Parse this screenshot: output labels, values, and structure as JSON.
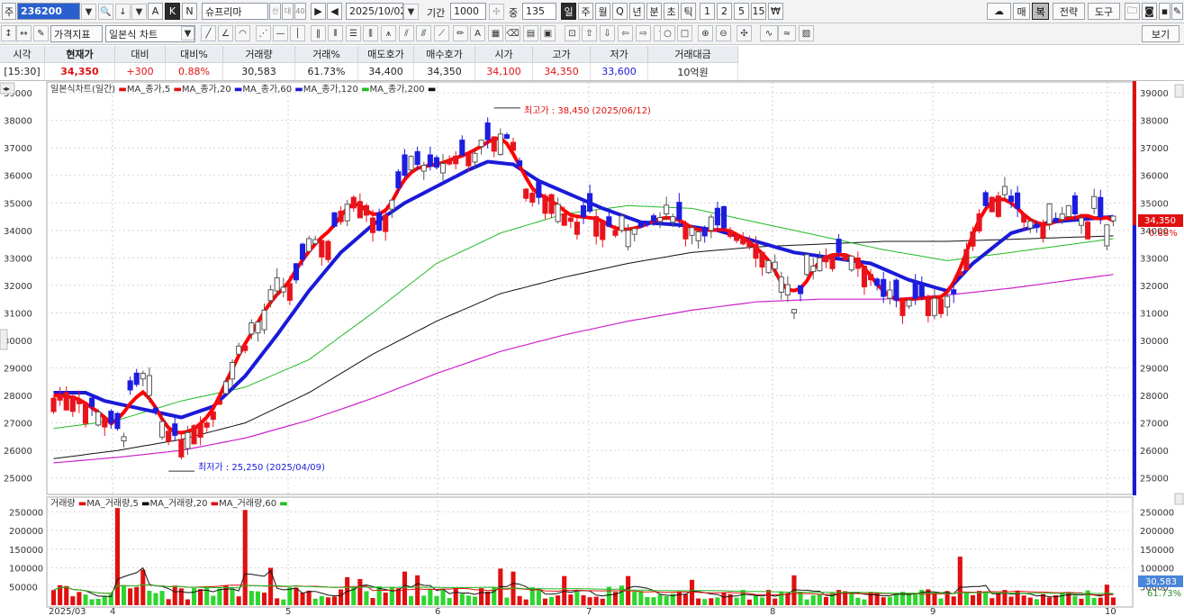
{
  "toolbar": {
    "code_prefix": "주",
    "code": "236200",
    "name": "슈프리마",
    "name_badges": [
      "신",
      "대",
      "40"
    ],
    "date": "2025/10/02",
    "period_label": "기간",
    "period_value": "1000",
    "count_label": "중",
    "count_value": "135",
    "intervals": [
      "일",
      "주",
      "월",
      "Q",
      "년",
      "분",
      "초",
      "틱",
      "1",
      "2",
      "5",
      "15"
    ],
    "right_buttons": [
      "매",
      "복",
      "전략",
      "도구"
    ],
    "letters": [
      "A",
      "K",
      "N"
    ]
  },
  "toolbar2": {
    "price_indicator": "가격지표",
    "chart_type": "일본식 차트",
    "view_label": "보기"
  },
  "info": {
    "headers": [
      "시각",
      "현재가",
      "대비",
      "대비%",
      "거래량",
      "거래%",
      "매도호가",
      "매수호가",
      "시가",
      "고가",
      "저가",
      "거래대금"
    ],
    "values": [
      "[15:30]",
      "34,350",
      "+300",
      "0.88%",
      "30,583",
      "61.73%",
      "34,400",
      "34,350",
      "34,100",
      "34,350",
      "33,600",
      "10억원"
    ]
  },
  "colors": {
    "up": "#e8141c",
    "down": "#1d1de0",
    "ma5": "#ff0000",
    "ma20": "#1a1ad8",
    "ma60": "#22bb22",
    "ma120": "#111111",
    "ma200": "#cc22cc",
    "vol_up": "#e01010",
    "vol_down": "#2fd52f"
  },
  "chart_data": {
    "type": "candlestick",
    "legend_main": [
      "일본식차트(일간)",
      "MA_종가,5",
      "MA_종가,20",
      "MA_종가,60",
      "MA_종가,120",
      "MA_종가,200"
    ],
    "legend_volume": [
      "거래량",
      "MA_거래량,5",
      "MA_거래량,20",
      "MA_거래량,60"
    ],
    "ylim": [
      24500,
      39200
    ],
    "y_ticks": [
      25000,
      26000,
      27000,
      28000,
      29000,
      30000,
      31000,
      32000,
      33000,
      34000,
      35000,
      36000,
      37000,
      38000,
      39000
    ],
    "vol_ticks": [
      "50000",
      "100000",
      "150000",
      "200000",
      "250000"
    ],
    "x_labels": [
      "2025/03",
      "4",
      "5",
      "6",
      "7",
      "8",
      "9",
      "10"
    ],
    "annotations": {
      "high": "최고가 : 38,450 (2025/06/12)",
      "low": "최저가 : 25,250 (2025/04/09)"
    },
    "last_price": "34,350",
    "last_change": "0.88%",
    "last_volume": "30,583",
    "last_volume_pct": "61.73%",
    "anchors": [
      [
        0,
        27900
      ],
      [
        2,
        28100
      ],
      [
        6,
        27600
      ],
      [
        8,
        27200
      ],
      [
        10,
        26800
      ],
      [
        11,
        26500
      ],
      [
        12,
        28200
      ],
      [
        14,
        28600
      ],
      [
        16,
        27400
      ],
      [
        18,
        26700
      ],
      [
        20,
        26400
      ],
      [
        22,
        26900
      ],
      [
        24,
        27000
      ],
      [
        26,
        27800
      ],
      [
        28,
        29200
      ],
      [
        30,
        29800
      ],
      [
        33,
        31100
      ],
      [
        35,
        31800
      ],
      [
        38,
        32200
      ],
      [
        40,
        33700
      ],
      [
        43,
        33600
      ],
      [
        45,
        34700
      ],
      [
        47,
        35200
      ],
      [
        49,
        34900
      ],
      [
        51,
        34000
      ],
      [
        53,
        35100
      ],
      [
        55,
        36000
      ],
      [
        57,
        36400
      ],
      [
        60,
        36300
      ],
      [
        63,
        36700
      ],
      [
        66,
        36800
      ],
      [
        68,
        37300
      ],
      [
        70,
        37500
      ],
      [
        72,
        37200
      ],
      [
        74,
        35500
      ],
      [
        76,
        35200
      ],
      [
        78,
        35300
      ],
      [
        80,
        34600
      ],
      [
        82,
        34300
      ],
      [
        84,
        34700
      ],
      [
        86,
        34300
      ],
      [
        88,
        34000
      ],
      [
        90,
        34000
      ],
      [
        93,
        34200
      ],
      [
        96,
        34600
      ],
      [
        98,
        34400
      ],
      [
        100,
        34100
      ],
      [
        102,
        33800
      ],
      [
        104,
        34200
      ],
      [
        106,
        34000
      ],
      [
        108,
        33700
      ],
      [
        110,
        33500
      ],
      [
        112,
        32900
      ],
      [
        114,
        32300
      ],
      [
        116,
        31000
      ],
      [
        118,
        32400
      ],
      [
        120,
        33000
      ],
      [
        123,
        33200
      ],
      [
        126,
        33000
      ],
      [
        128,
        32400
      ],
      [
        130,
        31600
      ],
      [
        133,
        31400
      ],
      [
        136,
        31600
      ],
      [
        139,
        31500
      ],
      [
        141,
        31700
      ],
      [
        143,
        33300
      ],
      [
        145,
        34600
      ],
      [
        147,
        35200
      ],
      [
        149,
        35300
      ],
      [
        151,
        34800
      ],
      [
        154,
        34100
      ],
      [
        157,
        34300
      ],
      [
        160,
        34600
      ],
      [
        162,
        34300
      ],
      [
        163,
        34800
      ],
      [
        165,
        34200
      ],
      [
        166,
        34350
      ]
    ],
    "ma20_anchors": [
      [
        0,
        28100
      ],
      [
        5,
        28100
      ],
      [
        8,
        27800
      ],
      [
        12,
        27600
      ],
      [
        20,
        27200
      ],
      [
        25,
        27600
      ],
      [
        30,
        28700
      ],
      [
        35,
        30200
      ],
      [
        40,
        31800
      ],
      [
        45,
        33200
      ],
      [
        50,
        34200
      ],
      [
        55,
        35000
      ],
      [
        60,
        35600
      ],
      [
        65,
        36200
      ],
      [
        68,
        36500
      ],
      [
        72,
        36400
      ],
      [
        76,
        35800
      ],
      [
        80,
        35400
      ],
      [
        86,
        34800
      ],
      [
        92,
        34300
      ],
      [
        98,
        34200
      ],
      [
        104,
        34000
      ],
      [
        110,
        33600
      ],
      [
        116,
        33200
      ],
      [
        122,
        33000
      ],
      [
        128,
        32800
      ],
      [
        134,
        32200
      ],
      [
        140,
        31800
      ],
      [
        144,
        32800
      ],
      [
        150,
        33900
      ],
      [
        156,
        34300
      ],
      [
        166,
        34500
      ]
    ],
    "ma60_anchors": [
      [
        0,
        26800
      ],
      [
        10,
        27100
      ],
      [
        20,
        27800
      ],
      [
        30,
        28300
      ],
      [
        40,
        29300
      ],
      [
        50,
        31000
      ],
      [
        60,
        32800
      ],
      [
        70,
        33900
      ],
      [
        80,
        34600
      ],
      [
        90,
        34900
      ],
      [
        100,
        34800
      ],
      [
        110,
        34300
      ],
      [
        120,
        33800
      ],
      [
        130,
        33300
      ],
      [
        140,
        32900
      ],
      [
        150,
        33200
      ],
      [
        166,
        33700
      ]
    ],
    "ma120_anchors": [
      [
        0,
        25700
      ],
      [
        10,
        26000
      ],
      [
        20,
        26400
      ],
      [
        30,
        27000
      ],
      [
        40,
        28100
      ],
      [
        50,
        29500
      ],
      [
        60,
        30700
      ],
      [
        70,
        31700
      ],
      [
        80,
        32300
      ],
      [
        90,
        32800
      ],
      [
        100,
        33200
      ],
      [
        110,
        33400
      ],
      [
        120,
        33500
      ],
      [
        130,
        33600
      ],
      [
        140,
        33600
      ],
      [
        166,
        33800
      ]
    ],
    "ma200_anchors": [
      [
        0,
        25550
      ],
      [
        10,
        25750
      ],
      [
        20,
        26000
      ],
      [
        30,
        26450
      ],
      [
        40,
        27100
      ],
      [
        50,
        27900
      ],
      [
        60,
        28800
      ],
      [
        70,
        29600
      ],
      [
        80,
        30200
      ],
      [
        90,
        30700
      ],
      [
        100,
        31100
      ],
      [
        110,
        31400
      ],
      [
        120,
        31500
      ],
      [
        130,
        31500
      ],
      [
        140,
        31650
      ],
      [
        150,
        31900
      ],
      [
        166,
        32400
      ]
    ],
    "volume_spikes": [
      [
        10,
        260000
      ],
      [
        12,
        45000
      ],
      [
        14,
        95000
      ],
      [
        30,
        255000
      ],
      [
        34,
        100000
      ],
      [
        46,
        75000
      ],
      [
        48,
        70000
      ],
      [
        55,
        90000
      ],
      [
        57,
        80000
      ],
      [
        70,
        98000
      ],
      [
        72,
        90000
      ],
      [
        80,
        78000
      ],
      [
        90,
        78000
      ],
      [
        100,
        68000
      ],
      [
        116,
        80000
      ],
      [
        142,
        130000
      ],
      [
        165,
        55000
      ]
    ]
  }
}
